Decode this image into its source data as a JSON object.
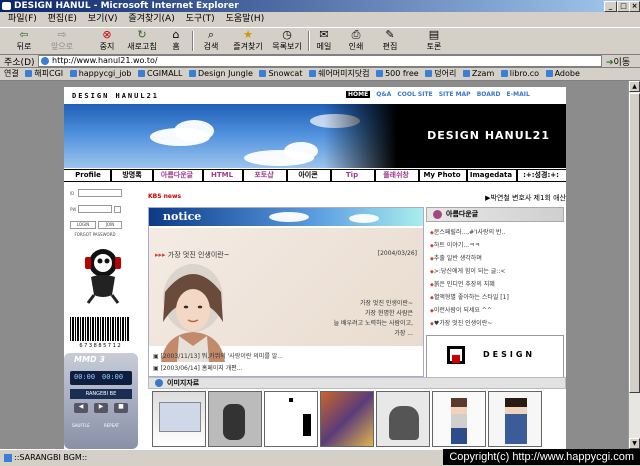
{
  "window": {
    "title": "DESIGN HANUL - Microsoft Internet Explorer",
    "min": "_",
    "max": "□",
    "close": "×"
  },
  "menu": [
    "파일(F)",
    "편집(E)",
    "보기(V)",
    "즐겨찾기(A)",
    "도구(T)",
    "도움말(H)"
  ],
  "toolbar": {
    "back": "뒤로",
    "forward": "앞으로",
    "stop": "중지",
    "refresh": "새로고침",
    "home": "홈",
    "search": "검색",
    "favorites": "즐겨찾기",
    "history": "목록보기",
    "mail": "메일",
    "print": "인쇄",
    "edit": "편집",
    "discuss": "토론"
  },
  "address": {
    "label": "주소(D)",
    "url": "http://www.hanul21.wo.to/",
    "go": "이동"
  },
  "links": {
    "label": "연결",
    "items": [
      "해피CGI",
      "happycgi_job",
      "CGIMALL",
      "Design Jungle",
      "Snowcat",
      "쉐어머미지닷컴",
      "500 free",
      "덩어리",
      "Zzam",
      "libro.co",
      "Adobe"
    ]
  },
  "site": {
    "logo": "DESIGN HANUL21",
    "topnav": [
      "HOME",
      "Q&A",
      "COOL SITE",
      "SITE MAP",
      "BOARD",
      "E-MAIL"
    ],
    "banner_title": "DESIGN HANUL21",
    "nav": [
      "Profile",
      "방명록",
      "아름다운글",
      "HTML",
      "포토샵",
      "아이콘",
      "Tip",
      "플래쉬창",
      "My Photo",
      "Imagedata",
      ":+:성경:+:"
    ],
    "login": {
      "id_label": "ID",
      "pw_label": "PW",
      "login_btn": "LOGIN",
      "join_btn": "JOIN",
      "forgot": "FORGOT PASSWORD"
    },
    "barcode_num": "6 7 3 8 8 5 7 1 2",
    "player": {
      "brand": "MMD 3",
      "time1": "00:00",
      "time2": "00:00",
      "label": "RANGEBI BE",
      "shuffle": "SHUFFLE",
      "repeat": "REPEAT"
    },
    "news": {
      "tag": "KBS news",
      "ticker": "박연철 변호사 제1회 애산"
    },
    "notice": {
      "title": "notice",
      "feature": "가장 멋진 인생이란~",
      "feature_date": "[2004/03/26]",
      "quote": [
        "가장 멋진 인생이란~",
        "가장 현명한 사람은",
        "늘 배우려고 노력하는 사람이고,",
        "가장 ..."
      ],
      "items": [
        {
          "text": "[2003/11/13] 뭐,카뷔의 '사랑이란 의미를 알..."
        },
        {
          "text": "[2003/06/14] 홈페이지 개편..."
        }
      ]
    },
    "downloads": {
      "title": "아름다운글",
      "items": [
        "문스페릴러...,#'I사랑의 반..",
        "하트 이야기...ㅋㅋ",
        "추출 일반 생각하며",
        ">:당신에게 힘이 되는 글::<",
        "붉은 인디언 추장의 지혜",
        "혈액형별 좋아하는 스타일 [1]",
        "이런사람이 되세요 ^^",
        "♥가장 멋진 인생이란~"
      ]
    },
    "design_logo": "DESIGN",
    "images_title": "이미지자료"
  },
  "status": "::SARANGBI BGM::",
  "copyright": "Copyright(c) http://www.happycgi.com"
}
